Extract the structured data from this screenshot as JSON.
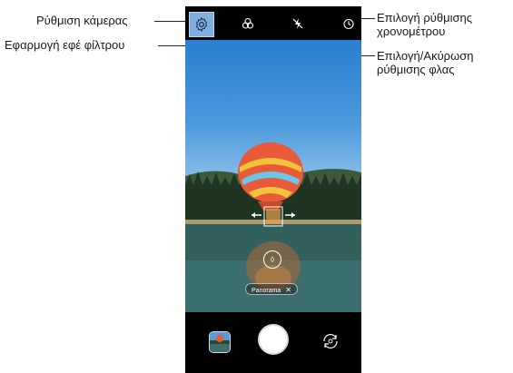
{
  "callouts": {
    "camera_settings": "Ρύθμιση κάμερας",
    "apply_filter": "Εφαρμογή εφέ φίλτρου",
    "timer_setting": "Επιλογή ρύθμισης χρονομέτρου",
    "flash_setting": "Επιλογή/Ακύρωση ρύθμισης φλας"
  },
  "viewfinder": {
    "mode_label": "Panorama",
    "mode_close": "✕"
  },
  "icons": {
    "settings": "gear-icon",
    "filter": "filter-icon",
    "flash": "flash-off-icon",
    "timer": "timer-icon",
    "gallery": "gallery-thumbnail",
    "shutter": "shutter-button",
    "switch_camera": "switch-camera-icon",
    "focus": "focus-icon",
    "arrows": "panorama-direction-arrows"
  },
  "colors": {
    "settings_highlight": "#7faee0",
    "shutter": "#ffffff",
    "phone_frame": "#000000"
  }
}
